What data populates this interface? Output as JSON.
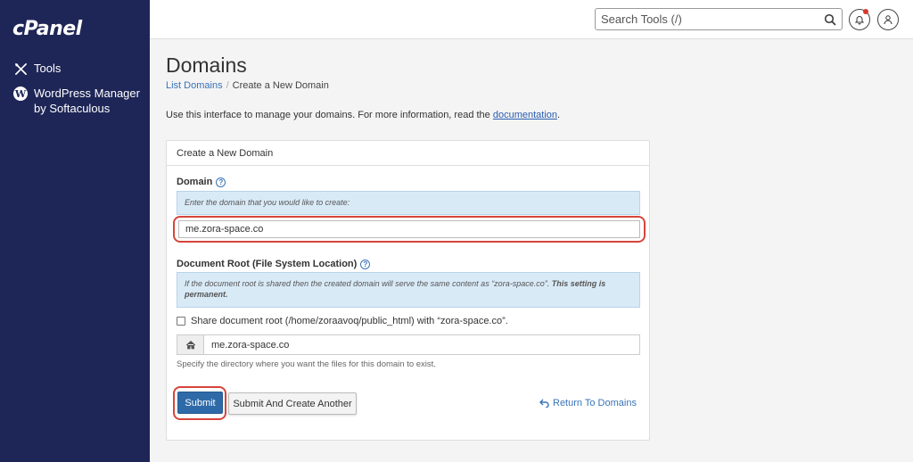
{
  "sidebar": {
    "logo": "cPanel",
    "items": [
      {
        "label": "Tools",
        "icon": "tools-icon"
      },
      {
        "label": "WordPress Manager by Softaculous",
        "icon": "wordpress-icon"
      }
    ]
  },
  "topbar": {
    "search_placeholder": "Search Tools (/)",
    "search_icon": "search-icon",
    "bell_icon": "bell-icon",
    "user_icon": "user-icon",
    "notification_color": "#d9372b"
  },
  "page": {
    "title": "Domains",
    "breadcrumb": {
      "link": "List Domains",
      "separator": "/",
      "current": "Create a New Domain"
    },
    "intro_text": "Use this interface to manage your domains. For more information, read the ",
    "intro_link": "documentation",
    "intro_end": "."
  },
  "form": {
    "panel_title": "Create a New Domain",
    "domain_label": "Domain",
    "domain_info": "Enter the domain that you would like to create:",
    "domain_value": "me.zora-space.co",
    "docroot_label": "Document Root (File System Location)",
    "docroot_info_1": "If the document root is shared then the created domain will serve the same content as “zora-space.co”. ",
    "docroot_info_2": "This setting is permanent.",
    "share_label": "Share document root (/home/zoraavoq/public_html) with “zora-space.co”.",
    "share_checked": false,
    "root_value": "me.zora-space.co",
    "root_hint": "Specify the directory where you want the files for this domain to exist.",
    "submit_label": "Submit",
    "submit_another_label": "Submit And Create Another",
    "return_label": "Return To Domains"
  },
  "colors": {
    "sidebar_bg": "#1e2657",
    "primary_button": "#2e6aa8",
    "highlight": "#d6453a",
    "link": "#3a73b8",
    "info_bg": "#d9eaf7"
  }
}
